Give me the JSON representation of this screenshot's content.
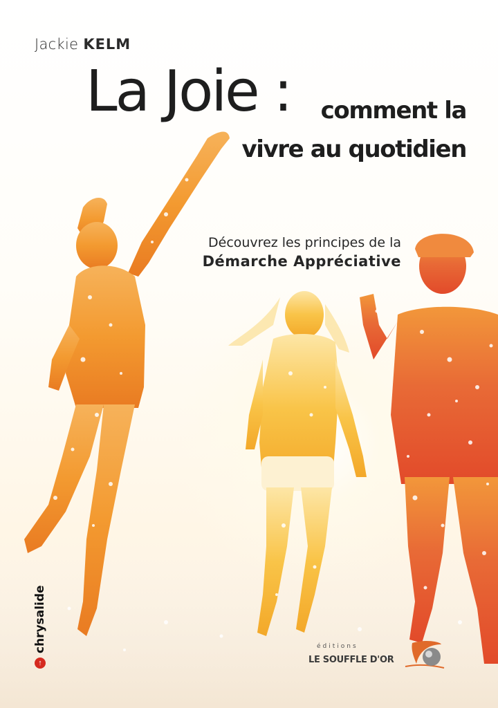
{
  "cover": {
    "author_first": "Jackie",
    "author_last": "KELM",
    "title_main": "La Joie :",
    "title_sub_line1": "comment la",
    "title_sub_line2": "vivre au quotidien",
    "subtitle_line1": "Découvrez les principes de la",
    "subtitle_line2": "Démarche Appréciative"
  },
  "collection": {
    "name": "chrysalide",
    "color": "#d52a1f"
  },
  "publisher": {
    "editions": "éditions",
    "name": "LE SOUFFLE D'OR"
  },
  "palette": {
    "text": "#1e1e1e",
    "warm_orange": "#f29a2e",
    "deep_orange": "#e4572e",
    "golden": "#f8c443"
  }
}
